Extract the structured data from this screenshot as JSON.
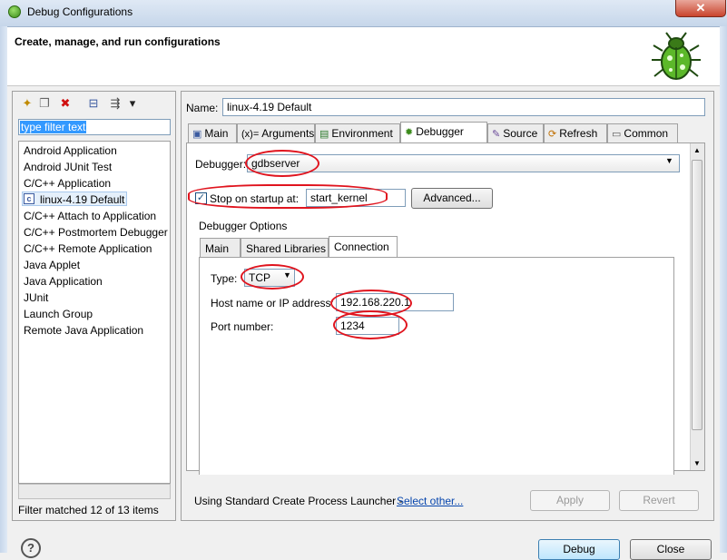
{
  "window": {
    "title": "Debug Configurations",
    "close_glyph": "✕"
  },
  "banner": {
    "title": "Create, manage, and run configurations",
    "icon": "bug-icon"
  },
  "left_panel": {
    "toolbar": [
      {
        "name": "new-config-icon",
        "glyph": "✦"
      },
      {
        "name": "duplicate-icon",
        "glyph": "❐"
      },
      {
        "name": "delete-icon",
        "glyph": "✖"
      },
      {
        "name": "collapse-all-icon",
        "glyph": "⊟"
      },
      {
        "name": "filter-icon",
        "glyph": "⇶"
      },
      {
        "name": "menu-dropdown-icon",
        "glyph": "▾"
      }
    ],
    "filter_text": "type filter text",
    "tree_items": [
      "Android Application",
      "Android JUnit Test",
      "C/C++ Application",
      "linux-4.19 Default",
      "C/C++ Attach to Application",
      "C/C++ Postmortem Debugger",
      "C/C++ Remote Application",
      "Java Applet",
      "Java Application",
      "JUnit",
      "Launch Group",
      "Remote Java Application"
    ],
    "status": "Filter matched 12 of 13 items"
  },
  "config": {
    "name_label": "Name:",
    "name_value": "linux-4.19 Default",
    "tabs": [
      {
        "label": "Main",
        "icon": "main-tab-icon"
      },
      {
        "label": "Arguments",
        "icon": "arguments-tab-icon"
      },
      {
        "label": "Environment",
        "icon": "environment-tab-icon"
      },
      {
        "label": "Debugger",
        "icon": "debugger-tab-icon",
        "active": true
      },
      {
        "label": "Source",
        "icon": "source-tab-icon"
      },
      {
        "label": "Refresh",
        "icon": "refresh-tab-icon"
      },
      {
        "label": "Common",
        "icon": "common-tab-icon"
      }
    ],
    "debugger_label": "Debugger:",
    "debugger_value": "gdbserver",
    "stop_on_startup_label": "Stop on startup at:",
    "stop_on_startup_checked": true,
    "stop_on_startup_value": "start_kernel",
    "advanced_button": "Advanced...",
    "options_label": "Debugger Options",
    "subtabs": [
      {
        "label": "Main"
      },
      {
        "label": "Shared Libraries"
      },
      {
        "label": "Connection",
        "active": true
      }
    ],
    "type_label": "Type:",
    "type_value": "TCP",
    "host_label": "Host name or IP address:",
    "host_value": "192.168.220.1",
    "port_label": "Port number:",
    "port_value": "1234",
    "launcher_text": "Using Standard Create Process Launcher -",
    "select_other_link": "Select other...",
    "apply_button": "Apply",
    "revert_button": "Revert"
  },
  "footer": {
    "help_glyph": "?",
    "debug_button": "Debug",
    "close_button": "Close"
  },
  "colors": {
    "annotation": "#e0141e",
    "selection": "#3399ff",
    "link": "#0645ad"
  }
}
